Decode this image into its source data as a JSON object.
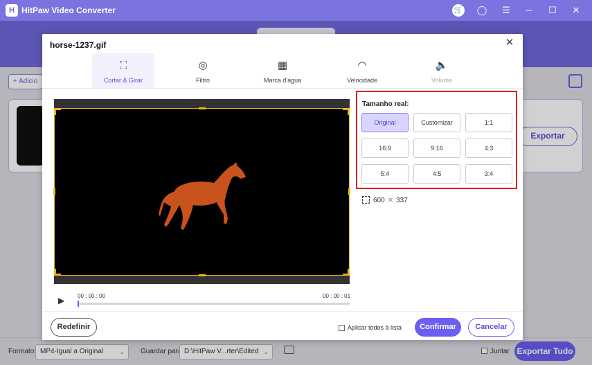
{
  "app": {
    "title": "HitPaw Video Converter",
    "logo_letter": "H",
    "add_label": "+ Adicio",
    "export_label": "Exportar"
  },
  "bottom_bar": {
    "format_label": "Formato:",
    "format_value": "MP4-Igual a Original",
    "save_label": "Guardar para:",
    "save_value": "D:\\HitPaw V...rter\\Edited",
    "join_label": "Juntar",
    "export_all_label": "Exportar Tudo"
  },
  "modal": {
    "title": "horse-1237.gif",
    "tabs": [
      {
        "label": "Cortar & Girar",
        "icon": "crop-icon",
        "state": "active"
      },
      {
        "label": "Filtro",
        "icon": "filter-icon",
        "state": "normal"
      },
      {
        "label": "Marca d'água",
        "icon": "watermark-icon",
        "state": "normal"
      },
      {
        "label": "Velocidade",
        "icon": "speed-icon",
        "state": "normal"
      },
      {
        "label": "Volume",
        "icon": "volume-icon",
        "state": "disabled"
      }
    ],
    "player": {
      "time_start": "00 : 00 : 00",
      "time_end": "00 : 00 : 01",
      "progress": 0
    },
    "ratio": {
      "title": "Tamanho real:",
      "options": [
        "Original",
        "Customizar",
        "1:1",
        "16:9",
        "9:16",
        "4:3",
        "5:4",
        "4:5",
        "3:4"
      ],
      "selected": "Original"
    },
    "size": {
      "width": "600",
      "height": "337"
    },
    "footer": {
      "reset_label": "Redefinir",
      "apply_all_label": "Aplicar todos à lista",
      "confirm_label": "Confirmar",
      "cancel_label": "Cancelar"
    }
  },
  "colors": {
    "accent": "#6a5ff0",
    "crop_frame": "#f4b31b",
    "highlight_box": "#e02020",
    "horse": "#c8531c"
  }
}
